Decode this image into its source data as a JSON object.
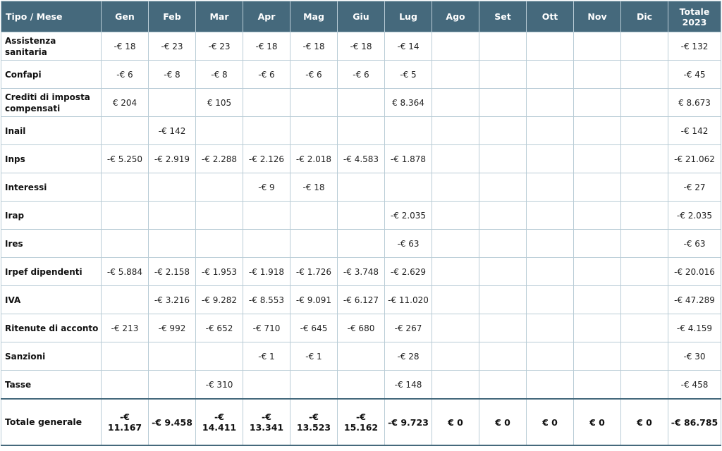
{
  "header": {
    "first": "Tipo / Mese",
    "months": [
      "Gen",
      "Feb",
      "Mar",
      "Apr",
      "Mag",
      "Giu",
      "Lug",
      "Ago",
      "Set",
      "Ott",
      "Nov",
      "Dic"
    ],
    "total_line1": "Totale",
    "total_line2": "2023"
  },
  "rows": [
    {
      "label": "Assistenza sanitaria",
      "values": [
        "-€ 18",
        "-€ 23",
        "-€ 23",
        "-€ 18",
        "-€ 18",
        "-€ 18",
        "-€ 14",
        "",
        "",
        "",
        "",
        ""
      ],
      "total": "-€ 132"
    },
    {
      "label": "Confapi",
      "values": [
        "-€ 6",
        "-€ 8",
        "-€ 8",
        "-€ 6",
        "-€ 6",
        "-€ 6",
        "-€ 5",
        "",
        "",
        "",
        "",
        ""
      ],
      "total": "-€ 45"
    },
    {
      "label": "Crediti di imposta compensati",
      "values": [
        "€ 204",
        "",
        "€ 105",
        "",
        "",
        "",
        "€ 8.364",
        "",
        "",
        "",
        "",
        ""
      ],
      "total": "€ 8.673"
    },
    {
      "label": "Inail",
      "values": [
        "",
        "-€ 142",
        "",
        "",
        "",
        "",
        "",
        "",
        "",
        "",
        "",
        ""
      ],
      "total": "-€ 142"
    },
    {
      "label": "Inps",
      "values": [
        "-€ 5.250",
        "-€ 2.919",
        "-€ 2.288",
        "-€ 2.126",
        "-€ 2.018",
        "-€ 4.583",
        "-€ 1.878",
        "",
        "",
        "",
        "",
        ""
      ],
      "total": "-€ 21.062"
    },
    {
      "label": "Interessi",
      "values": [
        "",
        "",
        "",
        "-€ 9",
        "-€ 18",
        "",
        "",
        "",
        "",
        "",
        "",
        ""
      ],
      "total": "-€ 27"
    },
    {
      "label": "Irap",
      "values": [
        "",
        "",
        "",
        "",
        "",
        "",
        "-€ 2.035",
        "",
        "",
        "",
        "",
        ""
      ],
      "total": "-€ 2.035"
    },
    {
      "label": "Ires",
      "values": [
        "",
        "",
        "",
        "",
        "",
        "",
        "-€ 63",
        "",
        "",
        "",
        "",
        ""
      ],
      "total": "-€ 63"
    },
    {
      "label": "Irpef dipendenti",
      "values": [
        "-€ 5.884",
        "-€ 2.158",
        "-€ 1.953",
        "-€ 1.918",
        "-€ 1.726",
        "-€ 3.748",
        "-€ 2.629",
        "",
        "",
        "",
        "",
        ""
      ],
      "total": "-€ 20.016"
    },
    {
      "label": "IVA",
      "values": [
        "",
        "-€ 3.216",
        "-€ 9.282",
        "-€ 8.553",
        "-€ 9.091",
        "-€ 6.127",
        "-€ 11.020",
        "",
        "",
        "",
        "",
        ""
      ],
      "total": "-€ 47.289"
    },
    {
      "label": "Ritenute di acconto",
      "values": [
        "-€ 213",
        "-€ 992",
        "-€ 652",
        "-€ 710",
        "-€ 645",
        "-€ 680",
        "-€ 267",
        "",
        "",
        "",
        "",
        ""
      ],
      "total": "-€ 4.159"
    },
    {
      "label": "Sanzioni",
      "values": [
        "",
        "",
        "",
        "-€ 1",
        "-€ 1",
        "",
        "-€ 28",
        "",
        "",
        "",
        "",
        ""
      ],
      "total": "-€ 30"
    },
    {
      "label": "Tasse",
      "values": [
        "",
        "",
        "-€ 310",
        "",
        "",
        "",
        "-€ 148",
        "",
        "",
        "",
        "",
        ""
      ],
      "total": "-€ 458"
    }
  ],
  "total_row": {
    "label": "Totale generale",
    "values": [
      "-€ 11.167",
      "-€ 9.458",
      "-€ 14.411",
      "-€ 13.341",
      "-€ 13.523",
      "-€ 15.162",
      "-€ 9.723",
      "€ 0",
      "€ 0",
      "€ 0",
      "€ 0",
      "€ 0"
    ],
    "total": "-€ 86.785"
  },
  "colors": {
    "header_bg": "#45697c",
    "header_text": "#ffffff",
    "grid": "#b9ccd6"
  }
}
